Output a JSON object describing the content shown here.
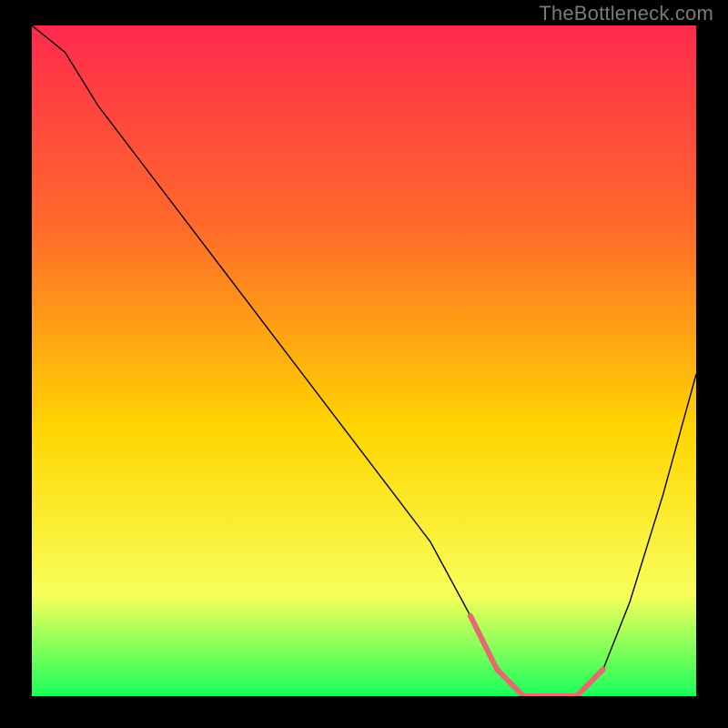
{
  "watermark": "TheBottleneck.com",
  "chart_data": {
    "type": "line",
    "title": "",
    "xlabel": "",
    "ylabel": "",
    "xlim": [
      0,
      100
    ],
    "ylim": [
      0,
      100
    ],
    "gradient": {
      "top": "#ff2a4d",
      "q1": "#ff6a2a",
      "mid": "#ffd500",
      "q3": "#f8ff5a",
      "bottom": "#18ff5a"
    },
    "series": [
      {
        "name": "curve",
        "x": [
          0,
          5,
          10,
          20,
          30,
          40,
          50,
          60,
          66,
          70,
          74,
          78,
          82,
          86,
          90,
          95,
          100
        ],
        "y": [
          100,
          96,
          88,
          75,
          62,
          49,
          36,
          23,
          12,
          4,
          0,
          0,
          0,
          4,
          14,
          30,
          48
        ],
        "stroke": "#000000",
        "stroke_width": 1.4
      },
      {
        "name": "highlight",
        "x": [
          66,
          70,
          74,
          78,
          82,
          86
        ],
        "y": [
          12,
          4,
          0,
          0,
          0,
          4
        ],
        "stroke": "#e46a6f",
        "stroke_width": 6
      }
    ]
  }
}
